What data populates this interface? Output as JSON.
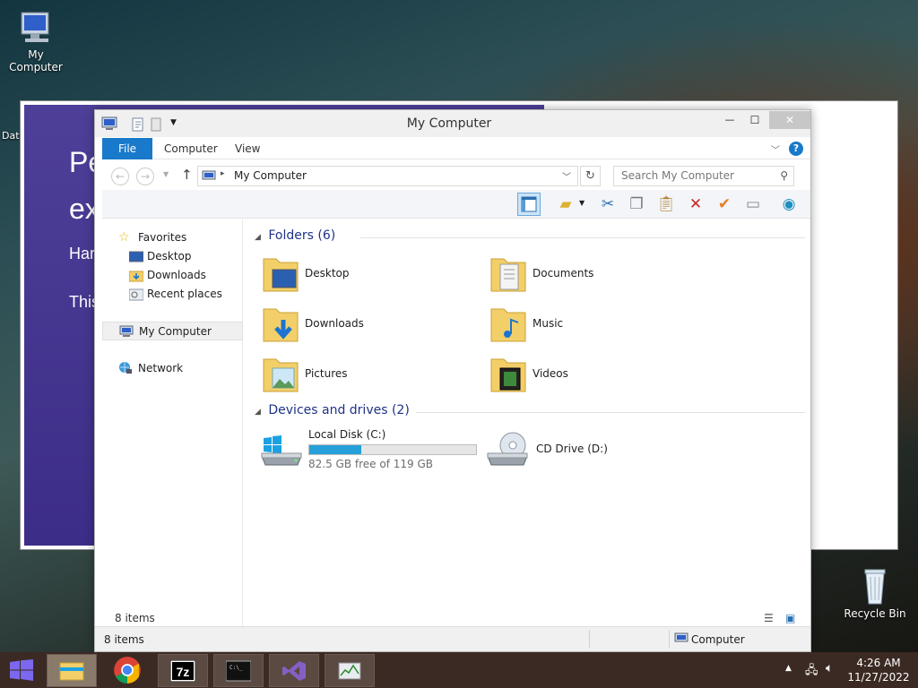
{
  "desktop": {
    "my_computer_label": "My Computer",
    "recycle_bin_label": "Recycle Bin",
    "partial_label": "Dat"
  },
  "background_window": {
    "line1": "Pe",
    "line2": "ex",
    "line3": "Har",
    "line4": "This"
  },
  "window": {
    "title": "My Computer",
    "controls": {
      "minimize": "—",
      "maximize": "☐",
      "close": "✕"
    }
  },
  "ribbon": {
    "file_tab": "File",
    "tabs": [
      "Computer",
      "View"
    ],
    "help": "?"
  },
  "address": {
    "path": "My Computer",
    "search_placeholder": "Search My Computer"
  },
  "toolbar": {
    "icons": [
      "preview-pane-icon",
      "properties-icon",
      "cut-icon",
      "copy-icon",
      "paste-icon",
      "delete-icon",
      "checkmark-icon",
      "rename-icon",
      "shell-icon"
    ]
  },
  "nav": {
    "favorites": "Favorites",
    "favorites_items": [
      "Desktop",
      "Downloads",
      "Recent places"
    ],
    "my_computer": "My Computer",
    "network": "Network"
  },
  "content": {
    "folders_header": "Folders (6)",
    "folders": [
      "Desktop",
      "Documents",
      "Downloads",
      "Music",
      "Pictures",
      "Videos"
    ],
    "devices_header": "Devices and drives (2)",
    "drive_c": {
      "name": "Local Disk (C:)",
      "free_text": "82.5 GB free of 119 GB",
      "used_fraction": 0.31
    },
    "drive_d": {
      "name": "CD Drive (D:)"
    }
  },
  "status": {
    "items_count": "8 items",
    "bottom_items": "8 items",
    "location": "Computer"
  },
  "taskbar": {
    "time": "4:26 AM",
    "date": "11/27/2022",
    "apps": [
      "file-explorer",
      "chrome",
      "7zip",
      "cmd",
      "visual-studio",
      "task-manager"
    ]
  },
  "colors": {
    "file_tab": "#1979ca",
    "accent": "#1e3287",
    "taskbar": "#3b2a23",
    "progress": "#26a0da"
  }
}
